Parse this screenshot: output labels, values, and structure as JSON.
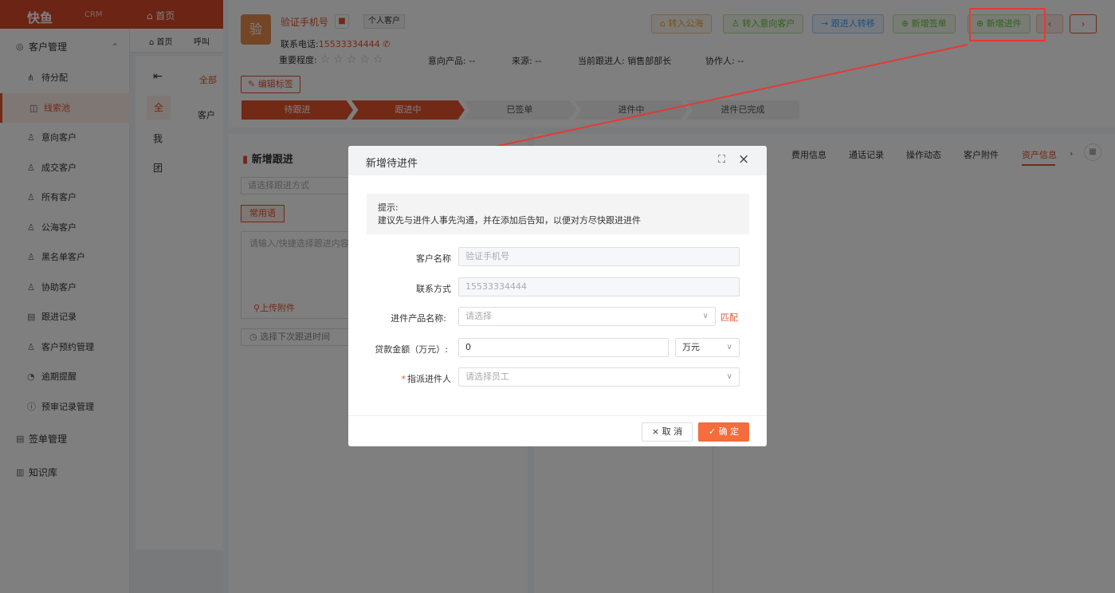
{
  "app": {
    "logo": "快鱼",
    "logo_suffix": "CRM",
    "top_nav_home": "⌂ 首页"
  },
  "sidebar": {
    "group_customers": "客户管理",
    "items": [
      {
        "label": "待分配",
        "icon": "fork-icon"
      },
      {
        "label": "线索池",
        "icon": "pool-icon",
        "active": true
      },
      {
        "label": "意向客户",
        "icon": "user-icon"
      },
      {
        "label": "成交客户",
        "icon": "user-icon"
      },
      {
        "label": "所有客户",
        "icon": "user-icon"
      },
      {
        "label": "公海客户",
        "icon": "user-icon"
      },
      {
        "label": "黑名单客户",
        "icon": "user-icon"
      },
      {
        "label": "协助客户",
        "icon": "user-icon"
      },
      {
        "label": "跟进记录",
        "icon": "doc-icon"
      },
      {
        "label": "客户预约管理",
        "icon": "user-icon"
      },
      {
        "label": "逾期提醒",
        "icon": "clock-icon"
      },
      {
        "label": "预审记录管理",
        "icon": "info-icon"
      }
    ],
    "group_sign": "签单管理",
    "group_knowledge": "知识库"
  },
  "mid": {
    "tab_home": "⌂ 首页",
    "tab_call": "呼叫",
    "row_all": "全",
    "row_mine": "我",
    "row_team": "团",
    "customer_label": "客户",
    "btn_all": "全部"
  },
  "customer": {
    "avatar_char": "验",
    "name": "验证手机号",
    "type_tag": "个人客户",
    "phone_label": "联系电话:",
    "phone": "15533334444",
    "importance_label": "重要程度:",
    "stars": 0,
    "intent_product_label": "意向产品:",
    "intent_product": "--",
    "source_label": "来源:",
    "source": "--",
    "follower_label": "当前跟进人:",
    "follower": "销售部部长",
    "assistant_label": "协作人:",
    "assistant": "--"
  },
  "actions": {
    "to_public": "转入公海",
    "to_intent": "转入意向客户",
    "transfer": "跟进人转移",
    "new_sign": "新增签单",
    "new_progress": "新增进件",
    "prev": "‹",
    "next": "›"
  },
  "edit_tag": "编辑标签",
  "steps": [
    "待跟进",
    "跟进中",
    "已签单",
    "进件中",
    "进件已完成"
  ],
  "follow": {
    "title": "新增跟进",
    "method_placeholder": "请选择跟进方式",
    "phrase_btn": "常用语",
    "content_placeholder": "请输入/快捷选择跟进内容",
    "upload": "上传附件",
    "next_time_placeholder": "选择下次跟进时间"
  },
  "right_tabs": [
    "费用信息",
    "通话记录",
    "操作动态",
    "客户附件",
    "资产信息"
  ],
  "dialog": {
    "title": "新增待进件",
    "tip_title": "提示:",
    "tip_text": "建议先与进件人事先沟通，并在添加后告知，以便对方尽快跟进进件",
    "customer_name_label": "客户名称",
    "customer_name_value": "验证手机号",
    "contact_label": "联系方式",
    "contact_value": "15533334444",
    "product_label": "进件产品名称:",
    "product_placeholder": "请选择",
    "match": "匹配",
    "loan_label": "贷款金额（万元）:",
    "loan_value": "0",
    "loan_unit": "万元",
    "assignee_label": "指派进件人",
    "assignee_placeholder": "请选择员工",
    "cancel": "取 消",
    "ok": "确 定"
  },
  "colors": {
    "brand": "#e5522d",
    "annotation": "#e53935"
  }
}
